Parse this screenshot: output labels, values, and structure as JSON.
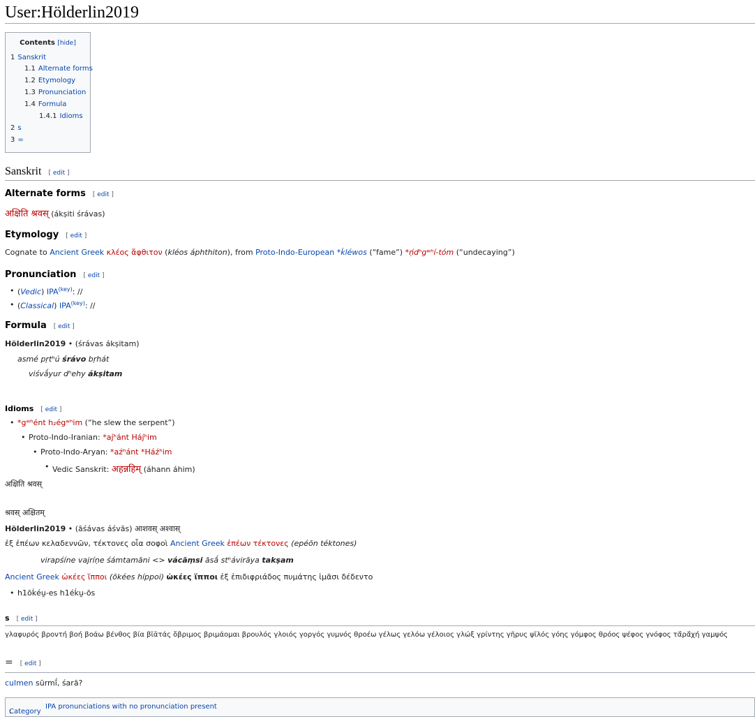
{
  "page": {
    "title": "User:Hölderlin2019"
  },
  "toc": {
    "title": "Contents",
    "hide": "[hide]",
    "items": [
      {
        "num": "1",
        "label": "Sanskrit"
      },
      {
        "num": "1.1",
        "label": "Alternate forms"
      },
      {
        "num": "1.2",
        "label": "Etymology"
      },
      {
        "num": "1.3",
        "label": "Pronunciation"
      },
      {
        "num": "1.4",
        "label": "Formula"
      },
      {
        "num": "1.4.1",
        "label": "Idioms"
      },
      {
        "num": "2",
        "label": "s"
      },
      {
        "num": "3",
        "label": "="
      }
    ]
  },
  "edit": {
    "open": "[ ",
    "label": "edit",
    "close": " ]"
  },
  "headings": {
    "sanskrit": "Sanskrit",
    "alternate": "Alternate forms",
    "etymology": "Etymology",
    "pronunciation": "Pronunciation",
    "formula": "Formula",
    "idioms": "Idioms",
    "s": "s",
    "eq": "="
  },
  "alternate": {
    "deva": "अक्षिति श्रवस्",
    "translit": " (ákṣiti śrávas)"
  },
  "etymology": {
    "p1": "Cognate to ",
    "link1": "Ancient Greek",
    "greek": " κλέος ἄφθιτον",
    "p2": " (",
    "tr": "kléos áphthiton",
    "p3": "), from ",
    "link2": "Proto-Indo-European",
    "pie1": " *ḱléwos",
    "p4": " (“fame”) ",
    "pie2": "*ṇ́dʰgʷʰí-tóm",
    "p5": " (“undecaying”)"
  },
  "pronunciation": [
    {
      "open": "(",
      "label": "Vedic",
      "close": ") ",
      "ipa": "IPA",
      "key": "(key)",
      "rest": ": //"
    },
    {
      "open": "(",
      "label": "Classical",
      "close": ") ",
      "ipa": "IPA",
      "key": "(key)",
      "rest": ": //"
    }
  ],
  "formula": {
    "head": "Hölderlin2019",
    "head_rest": " • (śrávas ákṣitam)",
    "l1a": "asmé pṛtʰú ",
    "l1b": "śrávo",
    "l1c": " bṛhát",
    "l2a": "viśvā́yur dʰehy ",
    "l2b": "ákṣitam"
  },
  "idioms": {
    "l1red": "*gʷʰént h₂égʷʰim",
    "l1rest": " (“he slew the serpent”)",
    "l2": "Proto-Indo-Iranian: ",
    "l2red": "*aȷ́ʰánt Háȷ́ʰim",
    "l3": "Proto-Indo-Aryan: ",
    "l3red": "*aźʰánt *Háźʰim",
    "l4": "Vedic Sanskrit: ",
    "l4red": "अहन्नहिम्",
    "l4rest": " (áhann áhim)"
  },
  "misc": {
    "deva1": "अक्षिति श्रवस्",
    "deva2": "श्रवस् अक्षितम्",
    "hold_bold": "Hölderlin2019",
    "hold_rest": " • (āśávas áśvās) आशवस् अश्वास्",
    "greek1a": "ἐξ ἐπέων κελαδεννῶν, τέκτονες οἷα σοφοὶ ",
    "greek1link": "Ancient Greek",
    "greek1red": " ἐπέων τέκτονες",
    "greek1tr": " (epéōn téktones)",
    "vir_a": "virapśíne vajríṇe śámtamāni <> ",
    "vir_b": "vácāṃsi",
    "vir_c": " āsā́ stʰávirāya ",
    "vir_d": "takṣam",
    "ag_link": "Ancient Greek",
    "ag_red": " ὠκέες ἵπποι",
    "ag_tr": " (ōkées híppoi) ",
    "ag_bold": "ὠκέες ἵπποι",
    "ag_rest": " ἐξ ἐπιδιφριάδος πυμάτης ἱμᾶσι δέδεντο",
    "h1": "h1ōḱéu̯-es h1éḱu̯-ōs"
  },
  "s_section": {
    "text": "γλαφυρός βροντή βοή βοάω βένθος βία βῖᾱτάς ὄβριμος βριμάομαι βρουλός γλοιός γοργός γυμνός θροέω γέλως γελόω γέλοιος γλώξ γρίντης γῆρυς ψῖλός γόης γόμφος θρόος ψέφος γνόφος τᾰ́ρᾰ́χή γαμψός"
  },
  "eq_section": {
    "link": "culmen",
    "rest": " sūrmī́, śarā?"
  },
  "category": {
    "label": "Category",
    "sep": ":  ",
    "value": "IPA pronunciations with no pronunciation present"
  }
}
